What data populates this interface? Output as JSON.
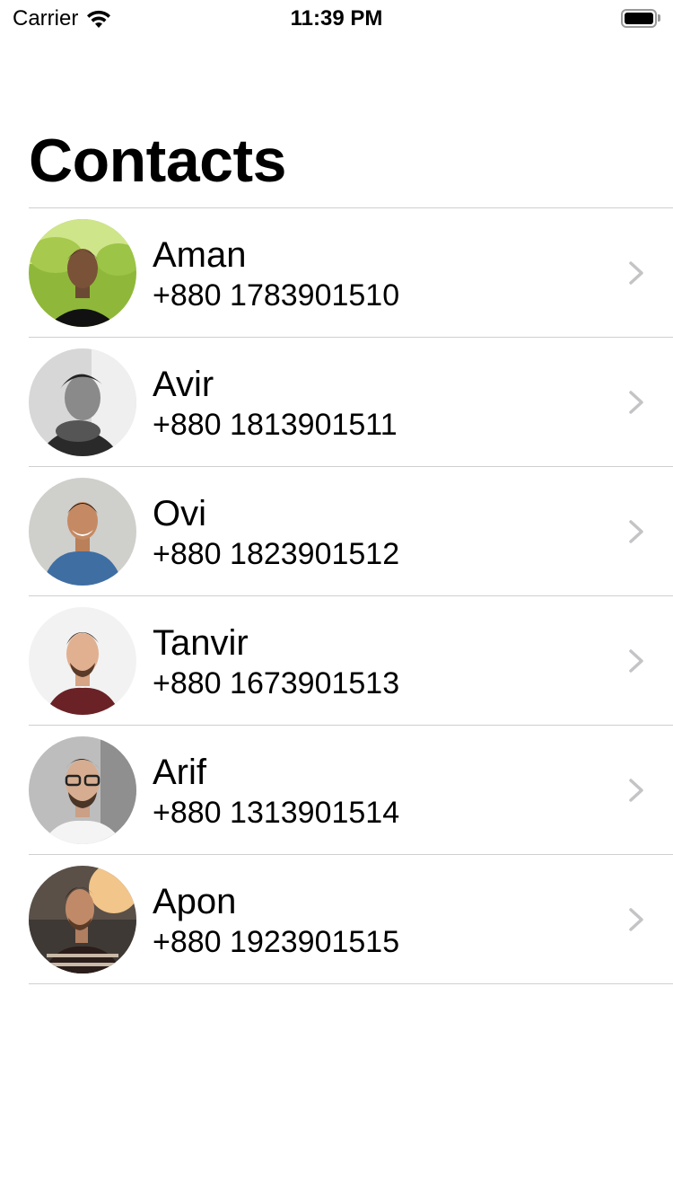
{
  "status_bar": {
    "carrier": "Carrier",
    "time": "11:39 PM"
  },
  "header": {
    "title": "Contacts"
  },
  "contacts": [
    {
      "name": "Aman",
      "phone": "+880 1783901510"
    },
    {
      "name": "Avir",
      "phone": "+880 1813901511"
    },
    {
      "name": "Ovi",
      "phone": "+880 1823901512"
    },
    {
      "name": "Tanvir",
      "phone": "+880 1673901513"
    },
    {
      "name": "Arif",
      "phone": "+880 1313901514"
    },
    {
      "name": "Apon",
      "phone": "+880 1923901515"
    }
  ],
  "icons": {
    "wifi": "wifi-icon",
    "battery": "battery-icon",
    "chevron": "chevron-right-icon"
  },
  "colors": {
    "separator": "#cfcfd3",
    "chevron": "#c4c4c7"
  }
}
